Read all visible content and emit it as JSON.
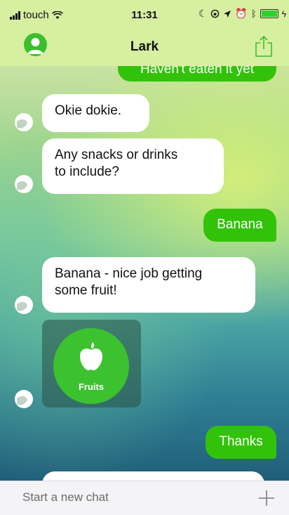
{
  "status_bar": {
    "carrier": "touch",
    "time": "11:31",
    "icons": [
      "signal-icon",
      "wifi-icon",
      "moon-icon",
      "lock-rotation-icon",
      "location-icon",
      "alarm-icon",
      "bluetooth-icon",
      "battery-icon",
      "charging-icon"
    ]
  },
  "nav": {
    "title": "Lark",
    "left_icon": "profile-icon",
    "right_icon": "share-icon"
  },
  "messages": [
    {
      "from": "user",
      "text": "Haven't eaten it yet"
    },
    {
      "from": "lark",
      "text": "Okie dokie."
    },
    {
      "from": "lark",
      "text": "Any snacks or drinks to include?",
      "lines": [
        "Any snacks or drinks",
        "to include?"
      ]
    },
    {
      "from": "user",
      "text": "Banana"
    },
    {
      "from": "lark",
      "text": "Banana - nice job getting some fruit!",
      "lines": [
        "Banana - nice job getting",
        "some fruit!"
      ]
    },
    {
      "from": "lark",
      "card": {
        "icon": "apple-icon",
        "label": "Fruits"
      }
    },
    {
      "from": "user",
      "text": "Thanks"
    }
  ],
  "composer": {
    "placeholder": "Start a new chat",
    "add_icon": "plus-icon"
  },
  "colors": {
    "accent_green": "#33c20a",
    "nav_bg": "#d6efa0",
    "incoming_bubble": "#ffffff"
  }
}
